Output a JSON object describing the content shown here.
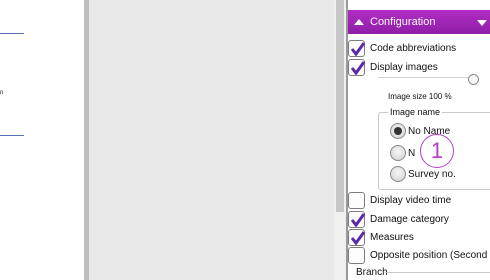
{
  "left_doc": {
    "stub_text": "n"
  },
  "panel": {
    "title": "Configuration",
    "checkboxes": [
      {
        "label": "Code abbreviations",
        "checked": true
      },
      {
        "label": "Display images",
        "checked": true
      },
      {
        "label": "Display video time",
        "checked": false
      },
      {
        "label": "Damage category",
        "checked": true
      },
      {
        "label": "Measures",
        "checked": true
      },
      {
        "label": "Opposite position (Second",
        "checked": false
      }
    ],
    "image_size_label": "Image size 100 %",
    "image_size_percent": 100,
    "image_name": {
      "title": "Image name",
      "options": [
        {
          "label": "No Name",
          "selected": true
        },
        {
          "label": "N",
          "selected": false
        },
        {
          "label": "Survey no.",
          "selected": false
        }
      ]
    },
    "callout_number": "1",
    "branch_label": "Branch"
  },
  "colors": {
    "accent": "#9b25b4",
    "callout": "#b33fc7",
    "check": "#5a2aa8"
  }
}
